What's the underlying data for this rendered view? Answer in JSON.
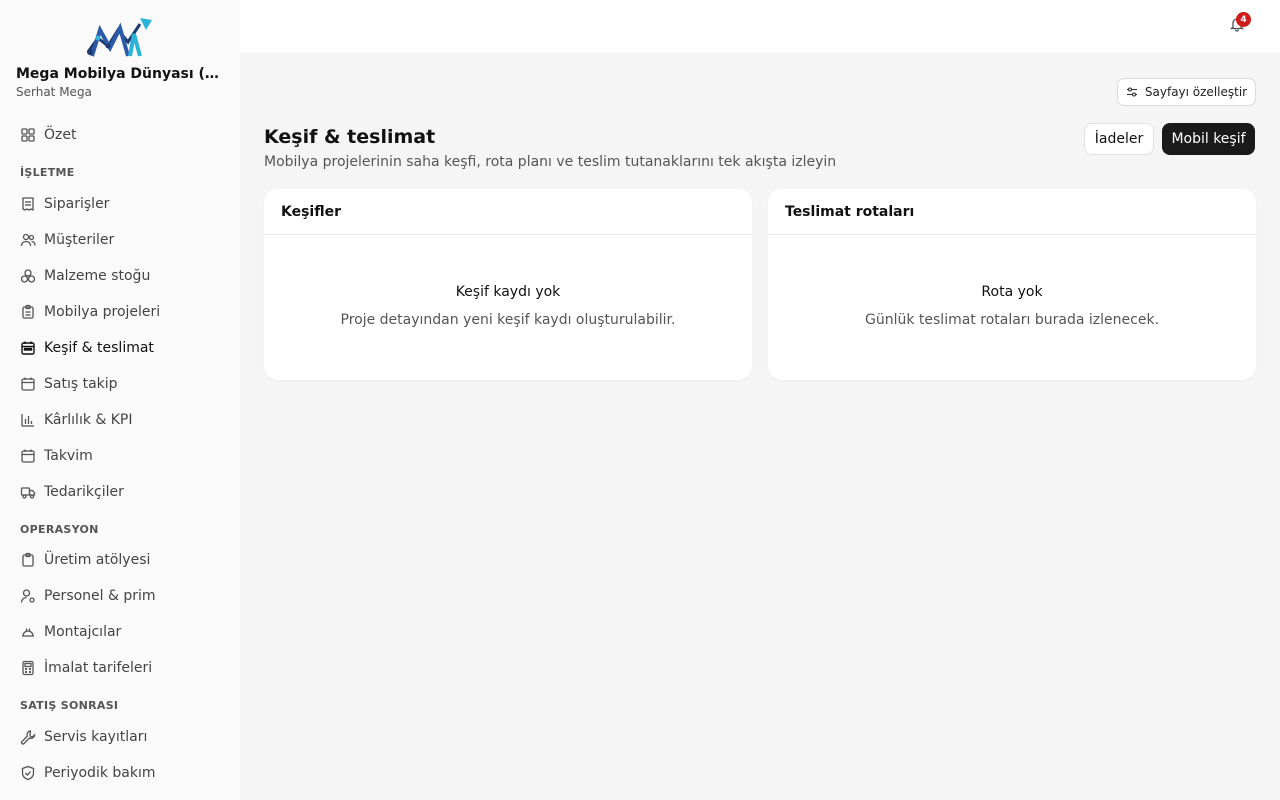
{
  "org": {
    "name": "Mega Mobilya Dünyası (Demo)",
    "user": "Serhat Mega"
  },
  "notifications": {
    "count": "4"
  },
  "sidebar": {
    "top": [
      {
        "label": "Özet",
        "icon": "grid-icon"
      }
    ],
    "sections": [
      {
        "title": "İŞLETME",
        "items": [
          {
            "label": "Siparişler",
            "icon": "receipt-icon"
          },
          {
            "label": "Müşteriler",
            "icon": "users-icon"
          },
          {
            "label": "Malzeme stoğu",
            "icon": "boxes-icon"
          },
          {
            "label": "Mobilya projeleri",
            "icon": "clipboard-icon"
          },
          {
            "label": "Keşif & teslimat",
            "icon": "calendar-icon",
            "active": true
          },
          {
            "label": "Satış takip",
            "icon": "calendar-icon"
          },
          {
            "label": "Kârlılık & KPI",
            "icon": "bar-chart-icon"
          },
          {
            "label": "Takvim",
            "icon": "calendar-icon"
          },
          {
            "label": "Tedarikçiler",
            "icon": "truck-icon"
          }
        ]
      },
      {
        "title": "OPERASYON",
        "items": [
          {
            "label": "Üretim atölyesi",
            "icon": "clipboard-icon"
          },
          {
            "label": "Personel & prim",
            "icon": "user-gear-icon"
          },
          {
            "label": "Montajcılar",
            "icon": "hardhat-icon"
          },
          {
            "label": "İmalat tarifeleri",
            "icon": "calculator-icon"
          }
        ]
      },
      {
        "title": "SATIŞ SONRASI",
        "items": [
          {
            "label": "Servis kayıtları",
            "icon": "wrench-icon"
          },
          {
            "label": "Periyodik bakım",
            "icon": "shield-icon"
          }
        ]
      }
    ]
  },
  "page": {
    "customize_label": "Sayfayı özelleştir",
    "title": "Keşif & teslimat",
    "subtitle": "Mobilya projelerinin saha keşfi, rota planı ve teslim tutanaklarını tek akışta izleyin",
    "returns_label": "İadeler",
    "mobile_label": "Mobil keşif"
  },
  "cards": [
    {
      "title": "Keşifler",
      "empty_title": "Keşif kaydı yok",
      "empty_desc": "Proje detayından yeni keşif kaydı oluşturulabilir."
    },
    {
      "title": "Teslimat rotaları",
      "empty_title": "Rota yok",
      "empty_desc": "Günlük teslimat rotaları burada izlenecek."
    }
  ]
}
